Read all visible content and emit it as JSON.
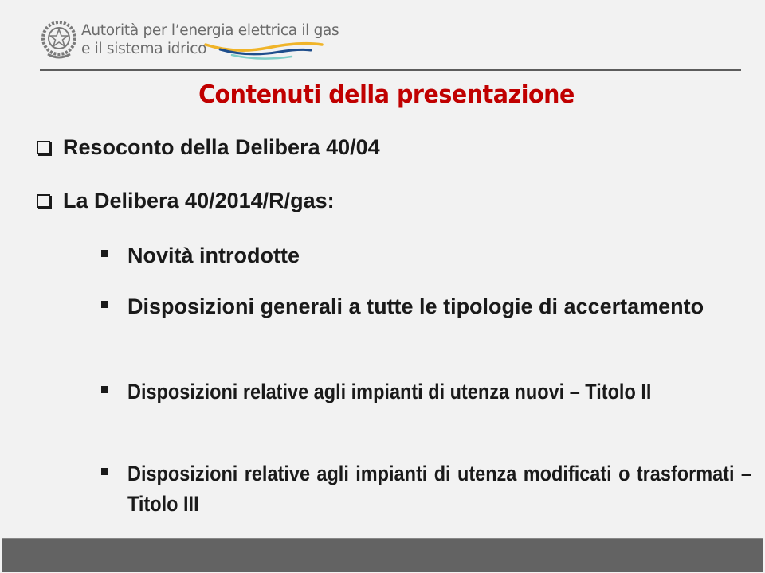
{
  "header": {
    "org_name_line1": "Autorità per l’energia elettrica il gas",
    "org_name_line2": "e il sistema idrico",
    "emblem_icon": "italian-republic-emblem-icon",
    "wave_colors": [
      "#f0b429",
      "#1f4e8c",
      "#7fcfc8"
    ]
  },
  "slide": {
    "title": "Contenuti della presentazione",
    "title_color": "#c00000",
    "items": [
      {
        "level": 1,
        "bullet": "checkbox-bullet",
        "text": "Resoconto della Delibera 40/04"
      },
      {
        "level": 1,
        "bullet": "checkbox-bullet",
        "text": "La Delibera 40/2014/R/gas:"
      },
      {
        "level": 2,
        "bullet": "square-bullet",
        "text": "Novità introdotte"
      },
      {
        "level": 2,
        "bullet": "square-bullet",
        "text": "Disposizioni generali a tutte le tipologie di accertamento"
      },
      {
        "level": 2,
        "bullet": "square-bullet",
        "text": "Disposizioni relative agli impianti di utenza nuovi – Titolo II"
      },
      {
        "level": 2,
        "bullet": "square-bullet",
        "text": "Disposizioni relative agli impianti di utenza modificati o trasformati – Titolo III"
      }
    ]
  },
  "footer": {
    "bar_color": "#636363"
  }
}
